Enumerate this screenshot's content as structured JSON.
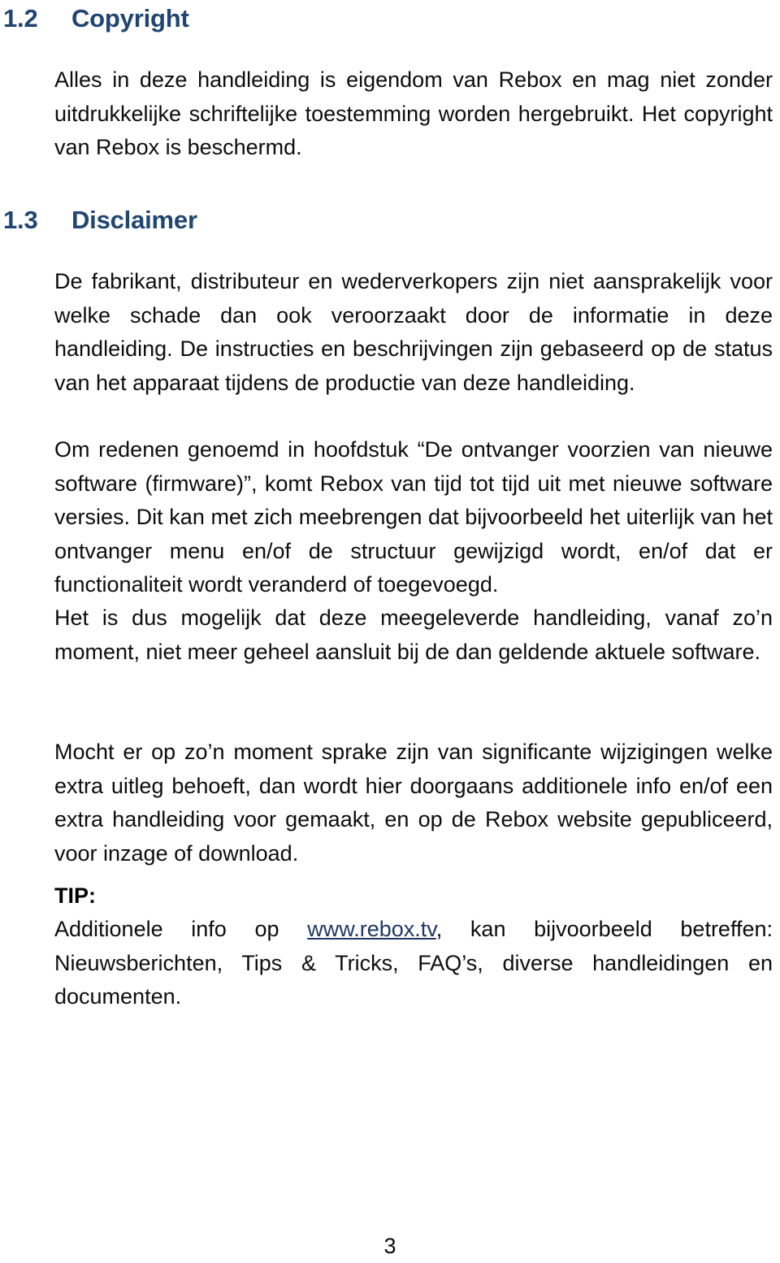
{
  "document": {
    "language": "nl",
    "page_number": "3",
    "heading_color": "#1F4570",
    "link_color": "#1F3864",
    "body_color": "#0D0D0D"
  },
  "sections": [
    {
      "number": "1.2",
      "title": "Copyright",
      "paragraphs": [
        "Alles in deze handleiding is eigendom van Rebox en mag niet zonder uitdrukkelijke schriftelijke toestemming worden hergebruikt. Het copyright van Rebox is beschermd."
      ]
    },
    {
      "number": "1.3",
      "title": "Disclaimer",
      "paragraphs": [
        "De fabrikant, distributeur en wederverkopers zijn niet aansprakelijk voor welke schade dan ook veroorzaakt door de informatie in deze handleiding. De instructies en beschrijvingen zijn gebaseerd op de status van het apparaat tijdens de productie van deze handleiding.",
        "Om redenen genoemd in hoofdstuk “De ontvanger voorzien van nieuwe software (firmware)”, komt Rebox van tijd tot tijd uit met nieuwe software versies. Dit kan met zich meebrengen dat bijvoorbeeld het uiterlijk van het ontvanger menu en/of de structuur gewijzigd wordt, en/of dat er functionaliteit wordt veranderd of toegevoegd.",
        "Het is dus mogelijk dat deze meegeleverde handleiding, vanaf zo’n moment, niet meer geheel aansluit bij de dan geldende aktuele software.",
        "Mocht er op zo’n moment sprake zijn van significante wijzigingen welke extra uitleg behoeft, dan wordt hier doorgaans additionele info en/of een extra handleiding voor gemaakt, en op de Rebox website gepubliceerd, voor inzage of download."
      ]
    }
  ],
  "tip": {
    "label": "TIP:",
    "line_before_link": "Additionele info op ",
    "link_text": "www.rebox.tv",
    "line_after_link": ", kan bijvoorbeeld betreffen: Nieuwsberichten, Tips & Tricks, FAQ’s, diverse handleidingen en documenten."
  }
}
